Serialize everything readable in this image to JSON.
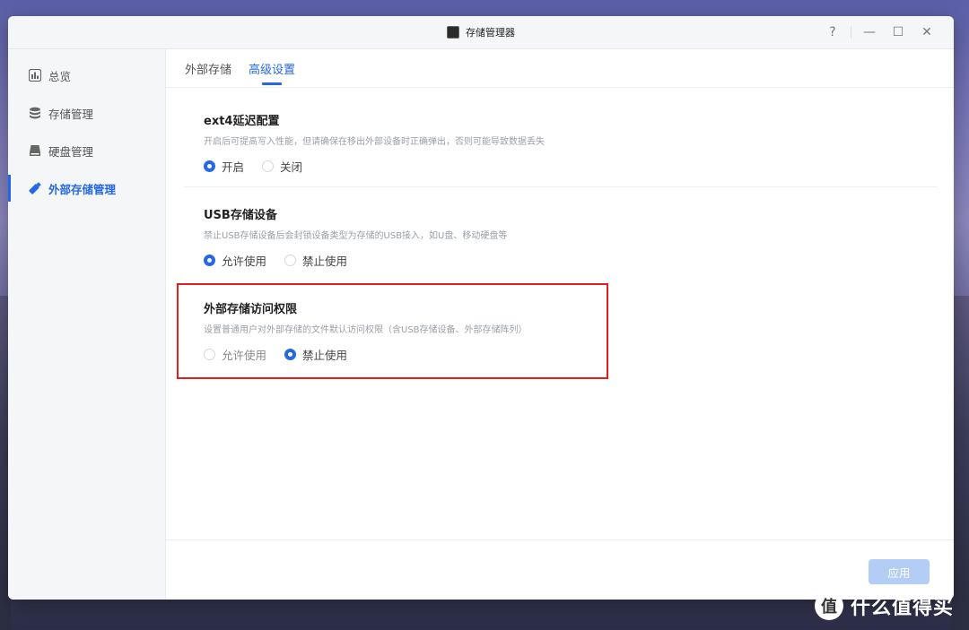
{
  "window": {
    "title": "存储管理器",
    "controls": [
      "?",
      "—",
      "☐",
      "✕"
    ]
  },
  "sidebar": {
    "items": [
      {
        "label": "总览",
        "icon": "chart-icon"
      },
      {
        "label": "存储管理",
        "icon": "database-icon"
      },
      {
        "label": "硬盘管理",
        "icon": "hard-disk-icon"
      },
      {
        "label": "外部存储管理",
        "icon": "usb-drive-icon",
        "active": true
      }
    ]
  },
  "tabs": [
    {
      "label": "外部存储"
    },
    {
      "label": "高级设置",
      "active": true
    }
  ],
  "sections": [
    {
      "title": "ext4延迟配置",
      "desc": "开启后可提高写入性能，但请确保在移出外部设备时正确弹出，否则可能导致数据丢失",
      "options": [
        {
          "label": "开启",
          "selected": true
        },
        {
          "label": "关闭",
          "selected": false
        }
      ]
    },
    {
      "title": "USB存储设备",
      "desc": "禁止USB存储设备后会封锁设备类型为存储的USB接入，如U盘、移动硬盘等",
      "options": [
        {
          "label": "允许使用",
          "selected": true
        },
        {
          "label": "禁止使用",
          "selected": false
        }
      ]
    },
    {
      "title": "外部存储访问权限",
      "desc": "设置普通用户对外部存储的文件默认访问权限（含USB存储设备、外部存储阵列）",
      "options": [
        {
          "label": "允许使用",
          "selected": false
        },
        {
          "label": "禁止使用",
          "selected": true
        }
      ]
    }
  ],
  "footer": {
    "apply_label": "应用"
  },
  "watermark": {
    "logo": "值",
    "text": "什么值得买"
  },
  "colors": {
    "accent": "#2468e5",
    "highlight": "#e02020",
    "apply_disabled": "#b3cdf5"
  }
}
